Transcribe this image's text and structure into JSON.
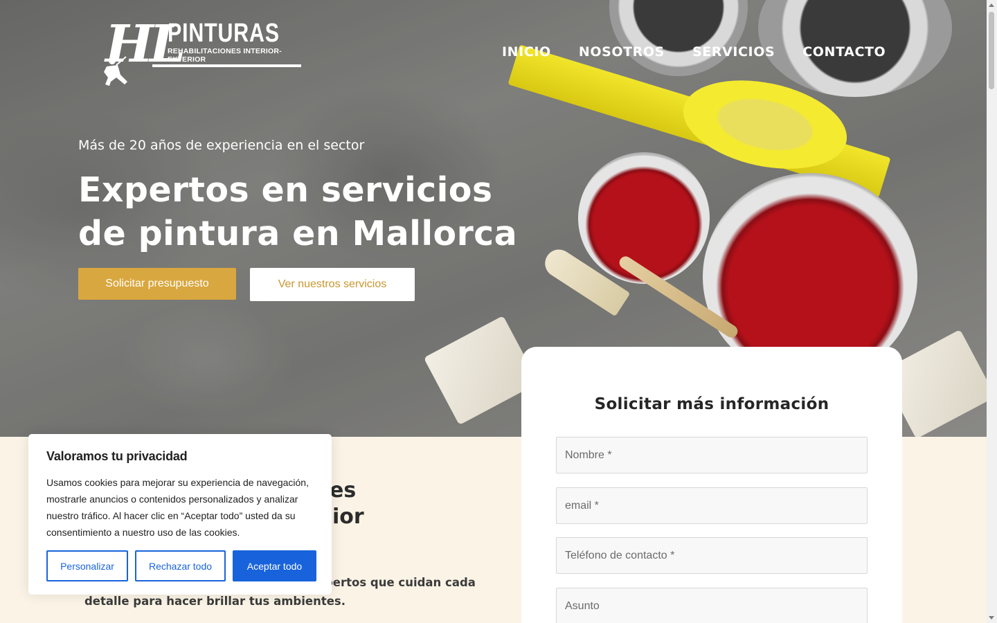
{
  "brand": {
    "logo_initials": "HL",
    "logo_title": "PINTURAS",
    "logo_subtitle": "REHABILITACIONES INTERIOR-EXTERIOR"
  },
  "nav": {
    "items": [
      {
        "label": "INICIO"
      },
      {
        "label": "NOSOTROS"
      },
      {
        "label": "SERVICIOS"
      },
      {
        "label": "CONTACTO"
      }
    ]
  },
  "hero": {
    "eyebrow": "Más de 20 años de experiencia en el sector",
    "title": "Expertos en servicios de pintura en Mallorca",
    "primary_button": "Solicitar presupuesto",
    "secondary_button": "Ver nuestros servicios"
  },
  "about": {
    "heading_visible_line1": "es",
    "heading_visible_line2": "ior",
    "text_line1_visible": "pertos que cuidan cada",
    "text_line2": "detalle para hacer brillar tus ambientes."
  },
  "form": {
    "title": "Solicitar más información",
    "fields": [
      {
        "placeholder": "Nombre *",
        "value": ""
      },
      {
        "placeholder": "email *",
        "value": ""
      },
      {
        "placeholder": "Teléfono de contacto *",
        "value": ""
      },
      {
        "placeholder": "Asunto",
        "value": ""
      }
    ]
  },
  "cookie": {
    "title": "Valoramos tu privacidad",
    "text": "Usamos cookies para mejorar su experiencia de navegación, mostrarle anuncios o contenidos personalizados y analizar nuestro tráfico. Al hacer clic en “Aceptar todo” usted da su consentimiento a nuestro uso de las cookies.",
    "customize_button": "Personalizar",
    "reject_button": "Rechazar todo",
    "accept_button": "Aceptar todo"
  },
  "colors": {
    "accent_gold": "#d9a73f",
    "cookie_blue": "#1863dc",
    "section_cream": "#fbf4e6"
  }
}
